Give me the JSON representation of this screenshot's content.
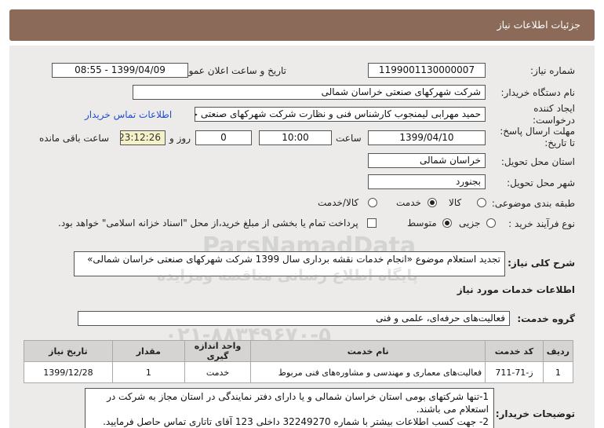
{
  "header": {
    "title": "جزئیات اطلاعات نیاز"
  },
  "form": {
    "need_number": {
      "label": "شماره نیاز:",
      "value": "1199001130000007"
    },
    "announce_datetime": {
      "label": "تاریخ و ساعت اعلان عمومی:",
      "value": "1399/04/09 - 08:55"
    },
    "buyer_org": {
      "label": "نام دستگاه خریدار:",
      "value": "شرکت شهرکهای صنعتی خراسان شمالی"
    },
    "requester": {
      "label_line1": "ایجاد کننده",
      "label_line2": "درخواست:",
      "value": "حمید مهرابی لیمنجوب کارشناس فنی و نظارت شرکت شهرکهای صنعتی خراس",
      "contact_link": "اطلاعات تماس خریدار"
    },
    "deadline": {
      "label_line1": "مهلت ارسال پاسخ:",
      "label_line2": "تا تاریخ:",
      "date": "1399/04/10",
      "time_label": "ساعت",
      "time": "10:00",
      "days": "0",
      "days_label": "روز و",
      "remaining": "23:12:26",
      "remaining_label": "ساعت باقی مانده"
    },
    "province": {
      "label": "استان محل تحویل:",
      "value": "خراسان شمالی"
    },
    "city": {
      "label": "شهر محل تحویل:",
      "value": "بجنورد"
    },
    "category": {
      "label": "طبقه بندی موضوعی:",
      "options": [
        "کالا",
        "خدمت",
        "کالا/خدمت"
      ],
      "selected": "خدمت"
    },
    "process_type": {
      "label": "نوع فرآیند خرید :",
      "options": [
        "جزیی",
        "متوسط"
      ],
      "selected": "متوسط",
      "payment_note": "پرداخت تمام یا بخشی از مبلغ خرید،از محل \"اسناد خزانه اسلامی\" خواهد بود."
    }
  },
  "summary": {
    "label": "شرح کلی نیاز:",
    "value": "تجدید استعلام موضوع «انجام خدمات نقشه برداری سال 1399 شرکت شهرکهای صنعتی خراسان شمالی»"
  },
  "services_info": {
    "title": "اطلاعات خدمات مورد نیاز",
    "group_label": "گروه خدمت:",
    "group_value": "فعالیت‌های حرفه‌ای، علمی و فنی"
  },
  "table": {
    "headers": [
      "ردیف",
      "کد خدمت",
      "نام خدمت",
      "واحد اندازه گیری",
      "مقدار",
      "تاریخ نیاز"
    ],
    "rows": [
      [
        "1",
        "ز-71-711",
        "فعالیت‌های معماری و مهندسی و مشاوره‌های فنی مربوط",
        "خدمت",
        "1",
        "1399/12/28"
      ]
    ]
  },
  "buyer_notes": {
    "label": "توضیحات خریدار:",
    "line1": "1-تنها شرکتهای بومی استان خراسان شمالی و یا دارای دفتر نمایندگی در استان مجاز به شرکت در",
    "line2": "استعلام می باشند.",
    "line3": "2- جهت کسب اطلاعات بیشتر با شماره 32249270 داخلی 123 آقای تاتاری تماس حاصل فرمایید."
  },
  "watermark": {
    "brand": "ParsNamadData",
    "line1": "پایگاه اطلاع رسانی مناقصه ومزایده",
    "line2": "۰۲۱-۸۸۳۴۹۶۷۰-۵"
  }
}
